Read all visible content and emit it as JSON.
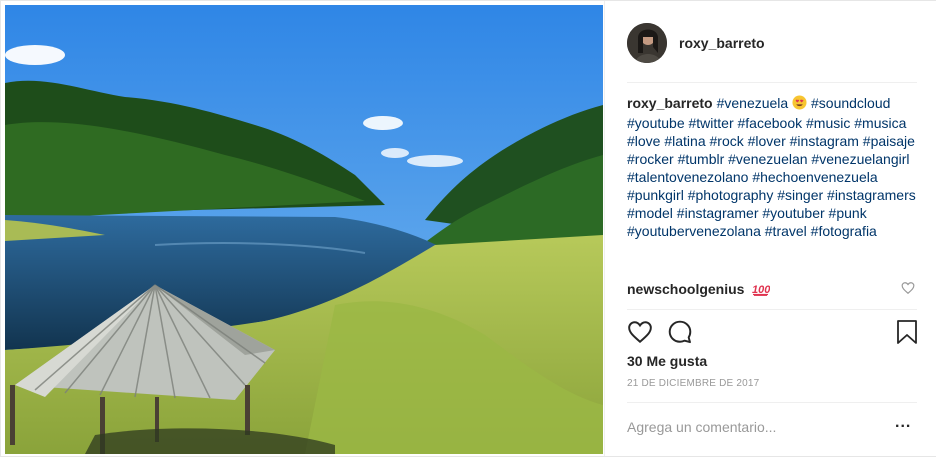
{
  "post": {
    "username": "roxy_barreto"
  },
  "caption": {
    "author": "roxy_barreto",
    "text": "#venezuela",
    "text_rest": "#soundcloud #youtube #twitter #facebook #music #musica #love #latina #rock #lover #instagram #paisaje #rocker #tumblr #venezuelan #venezuelangirl #talentovenezolano #hechoenvenezuela #punkgirl #photography #singer #instagramers #model #instagramer #youtuber #punk #youtubervenezolana #travel #fotografia",
    "emoji": "smiling-face-heart-eyes"
  },
  "comment": {
    "author": "newschoolgenius",
    "emoji": "hundred-points"
  },
  "likes": "30 Me gusta",
  "date": "21 DE DICIEMBRE DE 2017",
  "comment_input": {
    "placeholder": "Agrega un comentario..."
  },
  "more_label": "..."
}
